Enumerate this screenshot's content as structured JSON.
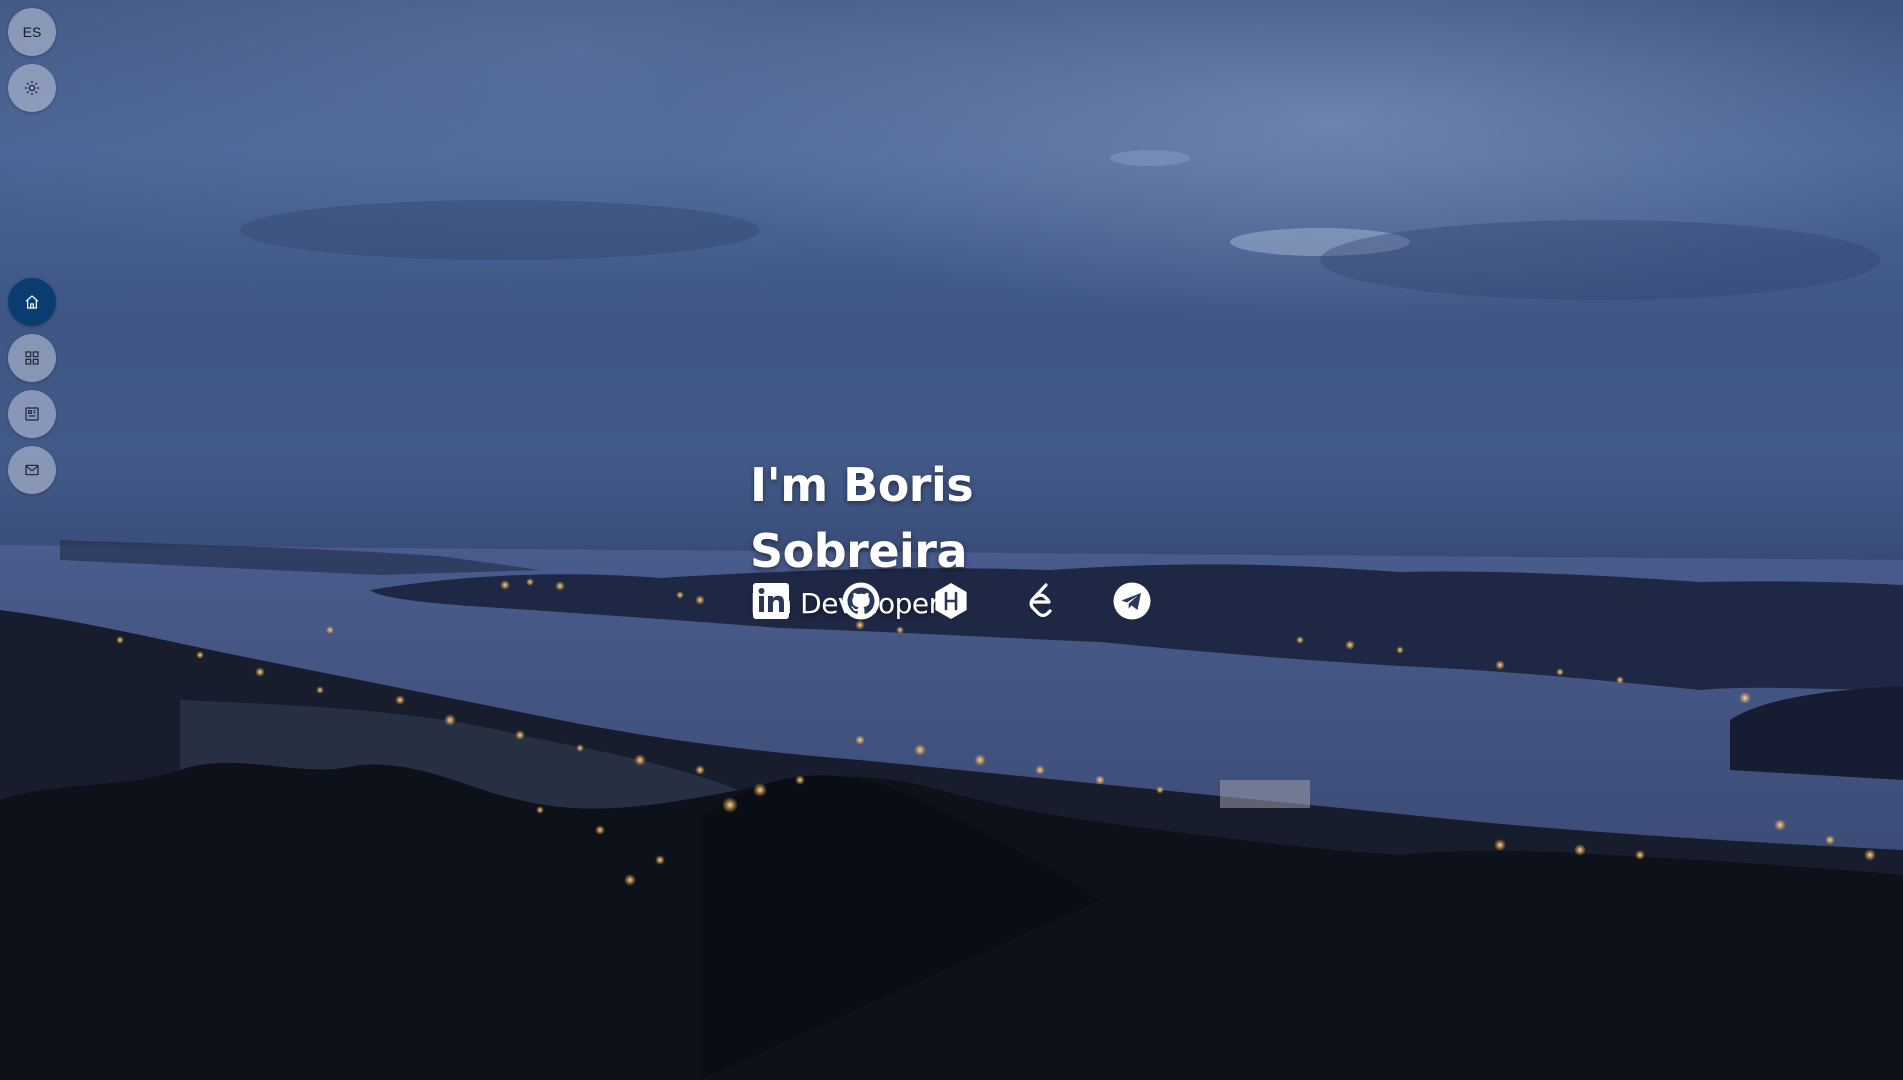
{
  "controls": {
    "language_label": "ES",
    "theme_icon": "sun-icon"
  },
  "nav": {
    "items": [
      {
        "icon": "home-icon",
        "active": true
      },
      {
        "icon": "grid-icon",
        "active": false
      },
      {
        "icon": "blog-icon",
        "active": false
      },
      {
        "icon": "mail-icon",
        "active": false
      }
    ]
  },
  "hero": {
    "title": "I'm Boris Sobreira",
    "subtitle": "I'm Developer"
  },
  "socials": [
    {
      "icon": "linkedin-icon"
    },
    {
      "icon": "github-icon"
    },
    {
      "icon": "hashnode-icon"
    },
    {
      "icon": "leetcode-icon"
    },
    {
      "icon": "telegram-icon"
    }
  ],
  "colors": {
    "active_nav": "#0b3d72",
    "control_bg": "#c3cbde",
    "text": "#ffffff"
  }
}
